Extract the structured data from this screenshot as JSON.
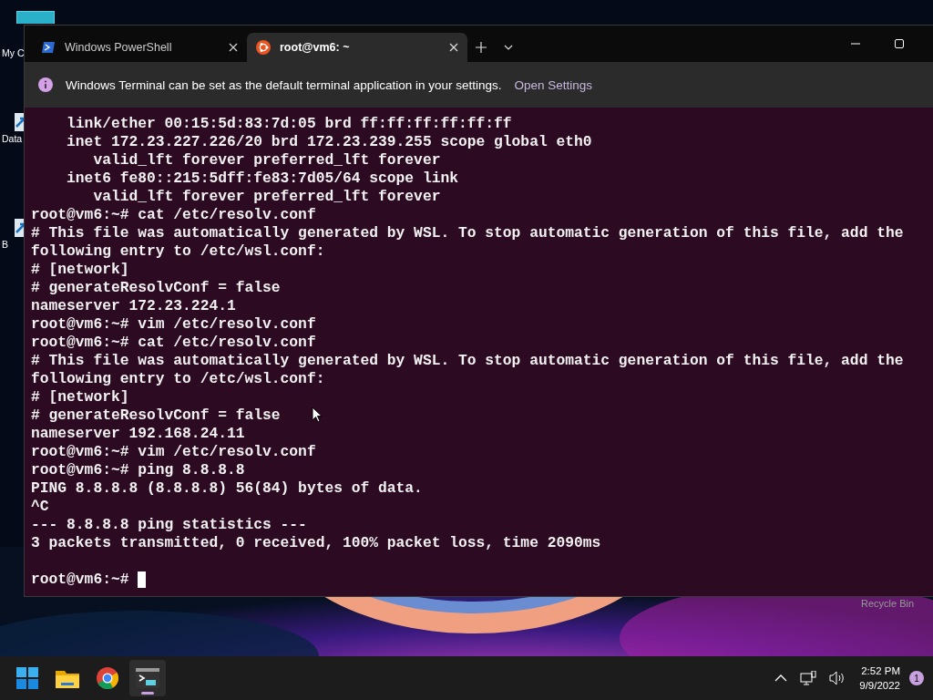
{
  "desktop": {
    "icons": [
      {
        "label": "My C",
        "kind": "computer"
      },
      {
        "label": "Data",
        "kind": "shortcut"
      },
      {
        "label": "B",
        "kind": "shortcut"
      },
      {
        "label": "Recycle Bin",
        "kind": "bin"
      }
    ]
  },
  "window": {
    "tabs": [
      {
        "title": "Windows PowerShell",
        "kind": "powershell",
        "selected": false
      },
      {
        "title": "root@vm6: ~",
        "kind": "ubuntu",
        "selected": true
      }
    ]
  },
  "infobar": {
    "message": "Windows Terminal can be set as the default terminal application in your settings.",
    "link": "Open Settings"
  },
  "terminal": {
    "lines": [
      "    link/ether 00:15:5d:83:7d:05 brd ff:ff:ff:ff:ff:ff",
      "    inet 172.23.227.226/20 brd 172.23.239.255 scope global eth0",
      "       valid_lft forever preferred_lft forever",
      "    inet6 fe80::215:5dff:fe83:7d05/64 scope link",
      "       valid_lft forever preferred_lft forever",
      "root@vm6:~# cat /etc/resolv.conf",
      "# This file was automatically generated by WSL. To stop automatic generation of this file, add the",
      "following entry to /etc/wsl.conf:",
      "# [network]",
      "# generateResolvConf = false",
      "nameserver 172.23.224.1",
      "root@vm6:~# vim /etc/resolv.conf",
      "root@vm6:~# cat /etc/resolv.conf",
      "# This file was automatically generated by WSL. To stop automatic generation of this file, add the",
      "following entry to /etc/wsl.conf:",
      "# [network]",
      "# generateResolvConf = false",
      "nameserver 192.168.24.11",
      "root@vm6:~# vim /etc/resolv.conf",
      "root@vm6:~# ping 8.8.8.8",
      "PING 8.8.8.8 (8.8.8.8) 56(84) bytes of data.",
      "^C",
      "--- 8.8.8.8 ping statistics ---",
      "3 packets transmitted, 0 received, 100% packet loss, time 2090ms"
    ],
    "prompt": "root@vm6:~#",
    "cursor": true
  },
  "taskbar": {
    "apps": [
      {
        "kind": "start",
        "selected": false
      },
      {
        "kind": "explorer",
        "selected": false
      },
      {
        "kind": "chrome",
        "selected": false
      },
      {
        "kind": "terminal",
        "selected": true
      }
    ],
    "time": "2:52 PM",
    "date": "9/9/2022",
    "notifications": "1"
  }
}
